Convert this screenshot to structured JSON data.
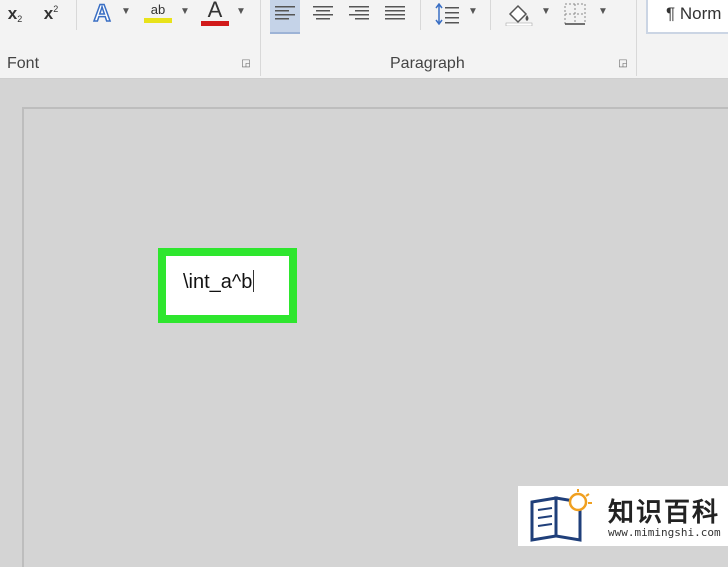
{
  "ribbon": {
    "font_group": {
      "label": "Font",
      "subscript_label": "x",
      "subscript_mark": "2",
      "superscript_label": "x",
      "superscript_mark": "2",
      "text_effects_glyph": "A",
      "highlight_glyph": "ab",
      "font_color_glyph": "A",
      "highlight_color": "#e8e21a",
      "font_color": "#d11a1a"
    },
    "paragraph_group": {
      "label": "Paragraph",
      "active_alignment": "align-left"
    },
    "styles": {
      "normal_label": "¶ Norm"
    }
  },
  "document": {
    "equation_text": "\\int_a^b",
    "highlight_color": "#2ee62e"
  },
  "watermark": {
    "title": "知识百科",
    "url": "www.mimingshi.com"
  }
}
